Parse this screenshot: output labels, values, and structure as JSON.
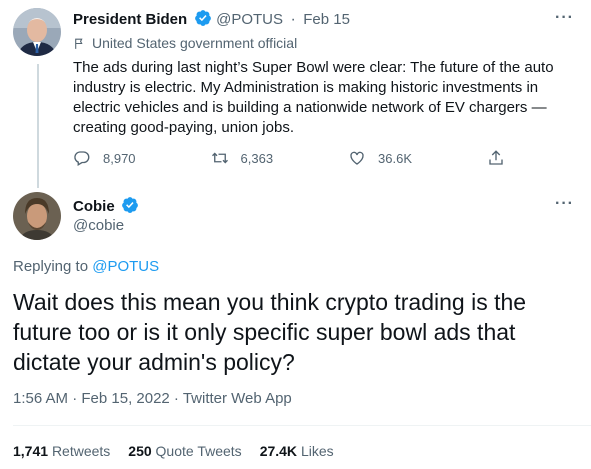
{
  "parent_tweet": {
    "author_name": "President Biden",
    "author_handle": "@POTUS",
    "date": "Feb 15",
    "dot": "·",
    "more": "···",
    "label": "United States government official",
    "text": "The ads during last night’s Super Bowl were clear: The future of the auto industry is electric. My Administration is making historic investments in electric vehicles and is building a nationwide network of EV chargers — creating good-paying, union jobs.",
    "replies": "8,970",
    "retweets": "6,363",
    "likes": "36.6K",
    "icons": {
      "reply": "reply-icon",
      "retweet": "retweet-icon",
      "like": "heart-icon",
      "share": "share-icon",
      "label": "flag-icon",
      "verified": "verified-badge-icon"
    }
  },
  "reply_tweet": {
    "author_name": "Cobie",
    "author_handle": "@cobie",
    "more": "···",
    "replying_prefix": "Replying to",
    "replying_to": "@POTUS",
    "text": "Wait does this mean you think crypto trading is the future too or is it only specific super bowl ads that dictate your admin's policy?",
    "meta": "1:56 AM · Feb 15, 2022 · Twitter Web App",
    "retweets_count": "1,741",
    "retweets_label": "Retweets",
    "quotes_count": "250",
    "quotes_label": "Quote Tweets",
    "likes_count": "27.4K",
    "likes_label": "Likes"
  },
  "colors": {
    "accent": "#1d9bf0",
    "text": "#0f1419",
    "muted": "#536471",
    "thread_line": "#cfd9de"
  }
}
